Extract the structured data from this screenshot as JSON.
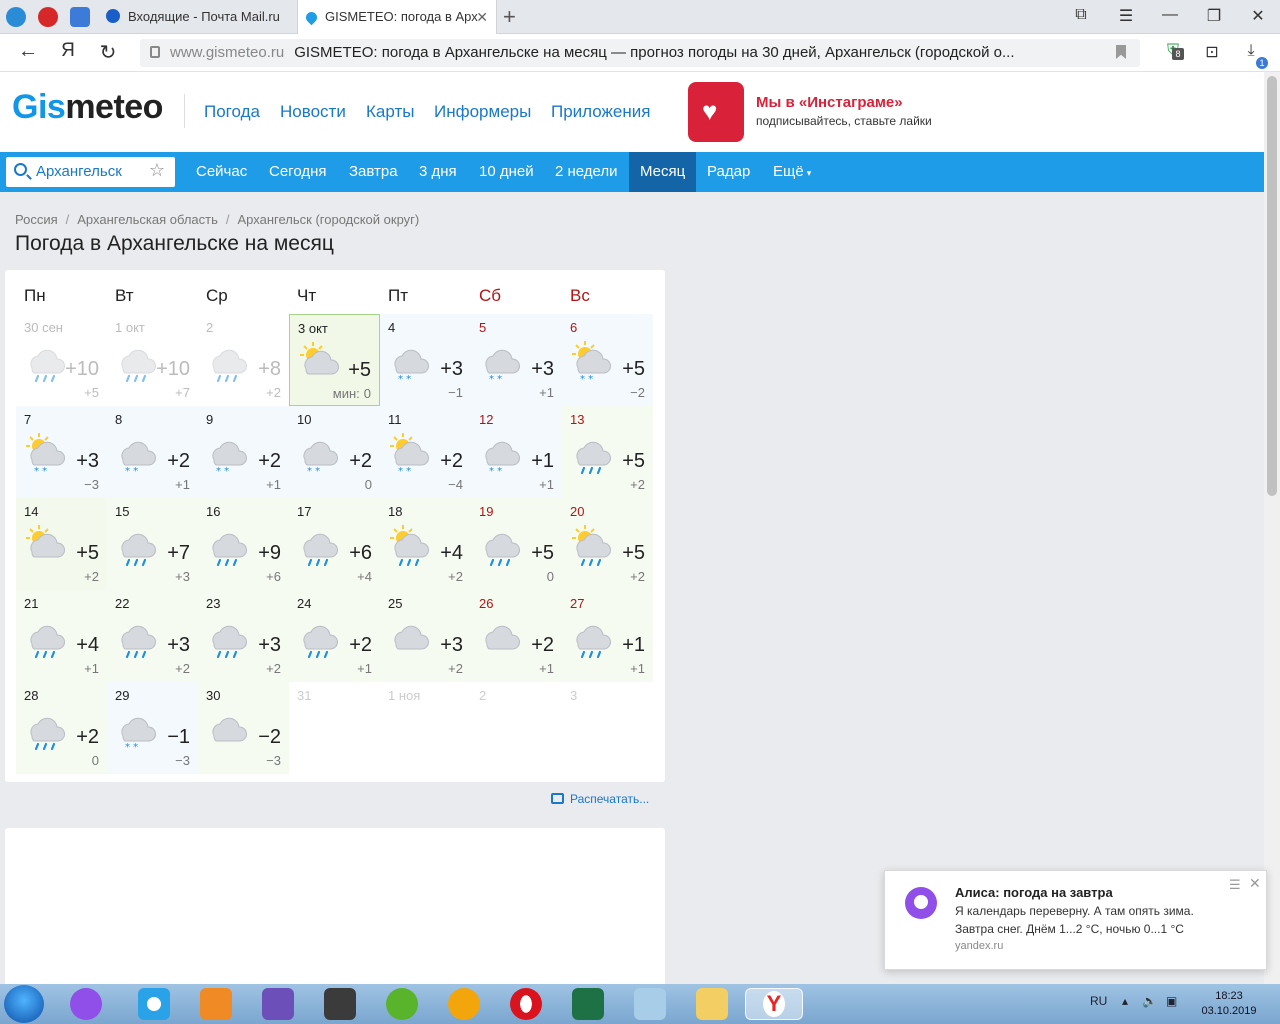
{
  "browser": {
    "tabs": [
      {
        "title": "Входящие - Почта Mail.ru"
      },
      {
        "title": "GISMETEO: погода в Арх"
      }
    ],
    "url_domain": "www.gismeteo.ru",
    "page_title": "GISMETEO: погода в Архангельске на месяц — прогноз погоды на 30 дней, Архангельск (городской о...",
    "ext_badge": "8",
    "download_badge": "1",
    "yandex_glyph": "Я"
  },
  "site": {
    "logo_a": "Gis",
    "logo_b": "meteo",
    "nav": [
      "Погода",
      "Новости",
      "Карты",
      "Информеры",
      "Приложения"
    ],
    "insta_title": "Мы в «Инстаграме»",
    "insta_sub": "подписывайтесь, ставьте лайки",
    "search_value": "Архангельск",
    "subnav": [
      "Сейчас",
      "Сегодня",
      "Завтра",
      "3 дня",
      "10 дней",
      "2 недели",
      "Месяц",
      "Радар",
      "Ещё"
    ],
    "subnav_active": 6,
    "breadcrumbs": [
      "Россия",
      "Архангельская область",
      "Архангельск (городской округ)"
    ],
    "heading": "Погода в Архангельске на месяц",
    "print_label": "Распечатать..."
  },
  "calendar": {
    "weekdays": [
      "Пн",
      "Вт",
      "Ср",
      "Чт",
      "Пт",
      "Сб",
      "Вс"
    ],
    "min_prefix": "мин:",
    "days": [
      {
        "d": "30 сен",
        "hi": "+10",
        "lo": "+5",
        "icon": "cloud-rain",
        "past": true
      },
      {
        "d": "1 окт",
        "hi": "+10",
        "lo": "+7",
        "icon": "cloud-rain",
        "past": true
      },
      {
        "d": "2",
        "hi": "+8",
        "lo": "+2",
        "icon": "cloud-rain",
        "past": true
      },
      {
        "d": "3 окт",
        "hi": "+5",
        "lo": "0",
        "icon": "sun-cloud",
        "today": true
      },
      {
        "d": "4",
        "hi": "+3",
        "lo": "−1",
        "icon": "cloud-snow"
      },
      {
        "d": "5",
        "hi": "+3",
        "lo": "+1",
        "icon": "cloud-snow",
        "we": true
      },
      {
        "d": "6",
        "hi": "+5",
        "lo": "−2",
        "icon": "sun-cloud-snow",
        "we": true
      },
      {
        "d": "7",
        "hi": "+3",
        "lo": "−3",
        "icon": "sun-cloud-snow"
      },
      {
        "d": "8",
        "hi": "+2",
        "lo": "+1",
        "icon": "cloud-snow"
      },
      {
        "d": "9",
        "hi": "+2",
        "lo": "+1",
        "icon": "cloud-snow"
      },
      {
        "d": "10",
        "hi": "+2",
        "lo": "0",
        "icon": "cloud-snow"
      },
      {
        "d": "11",
        "hi": "+2",
        "lo": "−4",
        "icon": "sun-cloud-snow"
      },
      {
        "d": "12",
        "hi": "+1",
        "lo": "+1",
        "icon": "cloud-snow",
        "we": true
      },
      {
        "d": "13",
        "hi": "+5",
        "lo": "+2",
        "icon": "cloud-rain",
        "we": true
      },
      {
        "d": "14",
        "hi": "+5",
        "lo": "+2",
        "icon": "sun-cloud"
      },
      {
        "d": "15",
        "hi": "+7",
        "lo": "+3",
        "icon": "cloud-rain"
      },
      {
        "d": "16",
        "hi": "+9",
        "lo": "+6",
        "icon": "cloud-rain"
      },
      {
        "d": "17",
        "hi": "+6",
        "lo": "+4",
        "icon": "cloud-rain"
      },
      {
        "d": "18",
        "hi": "+4",
        "lo": "+2",
        "icon": "sun-cloud-rain"
      },
      {
        "d": "19",
        "hi": "+5",
        "lo": "0",
        "icon": "cloud-rain",
        "we": true
      },
      {
        "d": "20",
        "hi": "+5",
        "lo": "+2",
        "icon": "sun-cloud-rain",
        "we": true
      },
      {
        "d": "21",
        "hi": "+4",
        "lo": "+1",
        "icon": "cloud-rain"
      },
      {
        "d": "22",
        "hi": "+3",
        "lo": "+2",
        "icon": "cloud-rain"
      },
      {
        "d": "23",
        "hi": "+3",
        "lo": "+2",
        "icon": "cloud-rain"
      },
      {
        "d": "24",
        "hi": "+2",
        "lo": "+1",
        "icon": "cloud-rain"
      },
      {
        "d": "25",
        "hi": "+3",
        "lo": "+2",
        "icon": "cloud"
      },
      {
        "d": "26",
        "hi": "+2",
        "lo": "+1",
        "icon": "cloud",
        "we": true
      },
      {
        "d": "27",
        "hi": "+1",
        "lo": "+1",
        "icon": "cloud-rain",
        "we": true
      },
      {
        "d": "28",
        "hi": "+2",
        "lo": "0",
        "icon": "cloud-rain"
      },
      {
        "d": "29",
        "hi": "−1",
        "lo": "−3",
        "icon": "cloud-snow"
      },
      {
        "d": "30",
        "hi": "−2",
        "lo": "−3",
        "icon": "cloud"
      },
      {
        "d": "31",
        "empty": true
      },
      {
        "d": "1 ноя",
        "empty": true
      },
      {
        "d": "2",
        "empty": true
      },
      {
        "d": "3",
        "empty": true
      }
    ]
  },
  "notification": {
    "title": "Алиса: погода на завтра",
    "line1": "Я календарь переверну. А там опять зима.",
    "line2": "Завтра снег. Днём 1...2 °C, ночью 0...1 °C",
    "source": "yandex.ru"
  },
  "taskbar": {
    "lang": "RU",
    "time": "18:23",
    "date": "03.10.2019"
  },
  "colors": {
    "brand_blue": "#1e9ce8",
    "active_tab": "#1465a8",
    "weekend_red": "#b01515",
    "insta_red": "#d9223a"
  }
}
